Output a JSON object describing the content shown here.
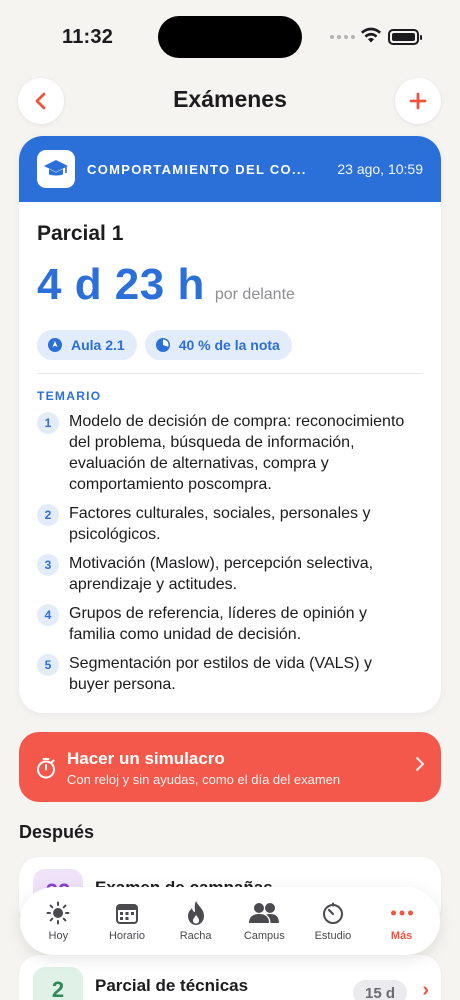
{
  "status": {
    "time": "11:32"
  },
  "nav": {
    "title": "Exámenes"
  },
  "exam": {
    "course": "COMPORTAMIENTO DEL CO...",
    "date": "23 ago, 10:59",
    "title": "Parcial 1",
    "countdown": "4 d 23 h",
    "countdown_suffix": "por delante",
    "room": "Aula 2.1",
    "weight": "40 % de la nota",
    "syllabus_label": "TEMARIO",
    "topics": [
      {
        "n": "1",
        "text": "Modelo de decisión de compra: reconocimiento del problema, búsqueda de información, evaluación de alternativas, compra y comportamiento poscompra."
      },
      {
        "n": "2",
        "text": "Factores culturales, sociales, personales y psicológicos."
      },
      {
        "n": "3",
        "text": "Motivación (Maslow), percepción selectiva, aprendizaje y actitudes."
      },
      {
        "n": "4",
        "text": "Grupos de referencia, líderes de opinión y familia como unidad de decisión."
      },
      {
        "n": "5",
        "text": "Segmentación por estilos de vida (VALS) y buyer persona."
      }
    ],
    "accent": "#2b6fd8"
  },
  "simulation": {
    "title": "Hacer un simulacro",
    "subtitle": "Con reloj y sin ayudas, como el día del examen",
    "color": "#f3584a"
  },
  "later": {
    "heading": "Después",
    "items": [
      {
        "badge": "22",
        "title": "Examen de campañas",
        "days": "",
        "badge_color": "#8b3fd1",
        "badge_bg": "#efe3fa"
      },
      {
        "badge": "2",
        "title": "Parcial de técnicas",
        "days": "15 d",
        "badge_color": "#2e8b57",
        "badge_bg": "#e0f2e7"
      }
    ]
  },
  "tabs": [
    {
      "label": "Hoy",
      "icon": "sun-icon"
    },
    {
      "label": "Horario",
      "icon": "calendar-icon"
    },
    {
      "label": "Racha",
      "icon": "flame-icon"
    },
    {
      "label": "Campus",
      "icon": "people-icon"
    },
    {
      "label": "Estudio",
      "icon": "timer-icon"
    },
    {
      "label": "Más",
      "icon": "more-icon",
      "active": true
    }
  ]
}
